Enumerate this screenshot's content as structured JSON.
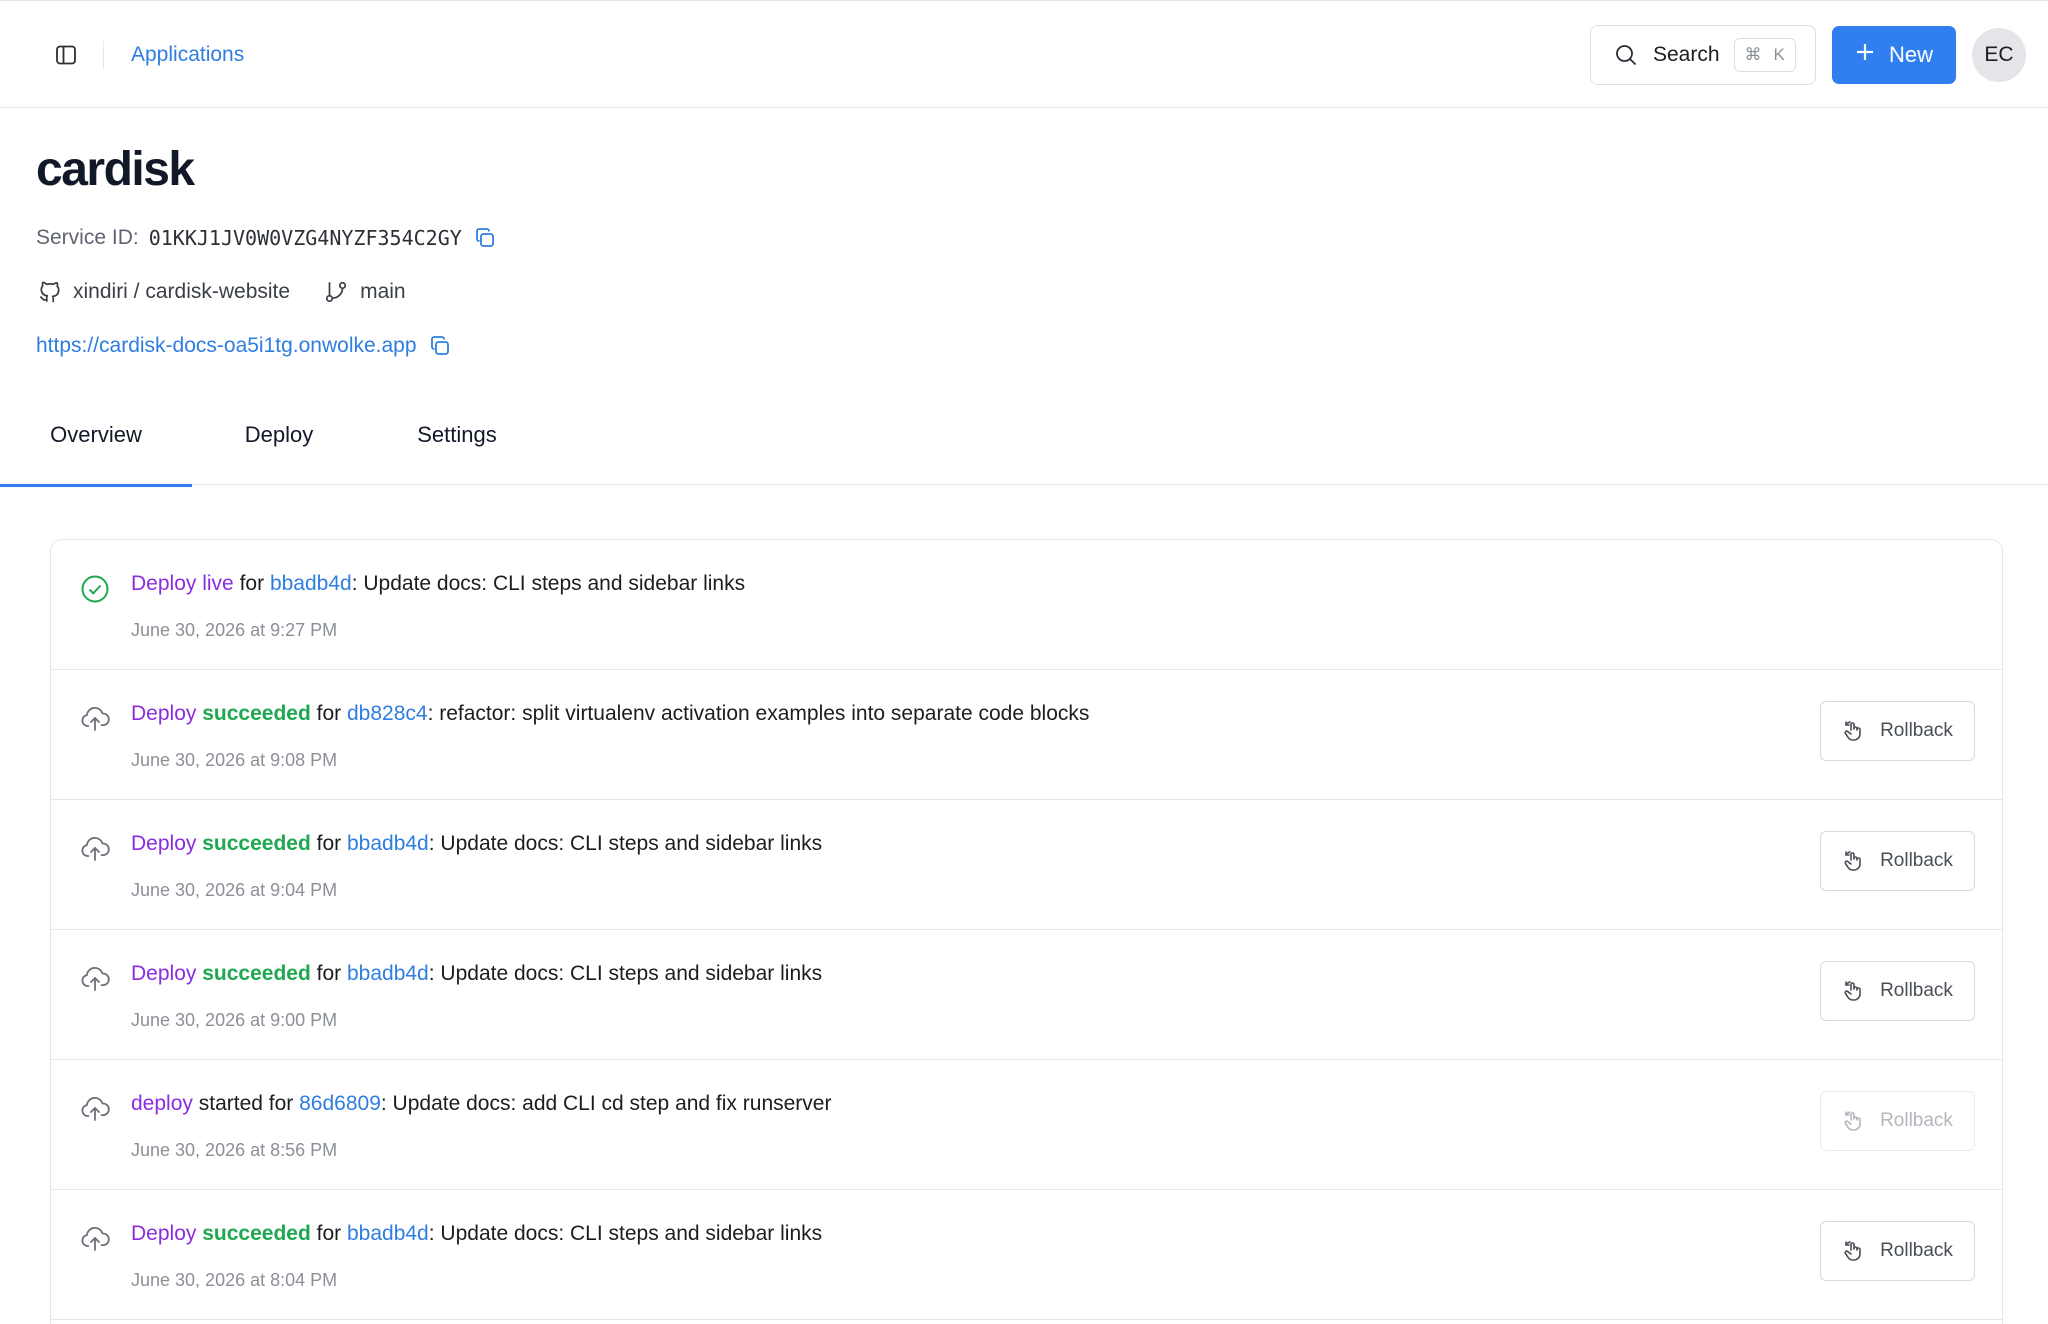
{
  "topbar": {
    "breadcrumb": "Applications",
    "search_label": "Search",
    "search_shortcut_mod": "⌘",
    "search_shortcut_key": "K",
    "new_label": "New",
    "avatar_initials": "EC"
  },
  "service": {
    "name": "cardisk",
    "id_label": "Service ID:",
    "id": "01KKJ1JV0W0VZG4NYZF354C2GY",
    "repo": "xindiri / cardisk-website",
    "branch": "main",
    "url": "https://cardisk-docs-oa5i1tg.onwolke.app"
  },
  "tabs": [
    "Overview",
    "Deploy",
    "Settings"
  ],
  "active_tab": "Overview",
  "colors": {
    "accent": "#2f7ff0",
    "link": "#2f7de1",
    "deploy_purple": "#8b2ce0",
    "success_green": "#1fa84f"
  },
  "events": [
    {
      "icon": "check-circle-icon",
      "word1": "Deploy",
      "status": "live",
      "connector": "for",
      "commit": "bbadb4d",
      "message": ": Update docs: CLI steps and sidebar links",
      "time": "June 30, 2026 at 9:27 PM",
      "rollback": null
    },
    {
      "icon": "cloud-upload-icon",
      "word1": "Deploy",
      "status": "succeeded",
      "connector": "for",
      "commit": "db828c4",
      "message": ": refactor: split virtualenv activation examples into separate code blocks",
      "time": "June 30, 2026 at 9:08 PM",
      "rollback": "Rollback"
    },
    {
      "icon": "cloud-upload-icon",
      "word1": "Deploy",
      "status": "succeeded",
      "connector": "for",
      "commit": "bbadb4d",
      "message": ": Update docs: CLI steps and sidebar links",
      "time": "June 30, 2026 at 9:04 PM",
      "rollback": "Rollback"
    },
    {
      "icon": "cloud-upload-icon",
      "word1": "Deploy",
      "status": "succeeded",
      "connector": "for",
      "commit": "bbadb4d",
      "message": ": Update docs: CLI steps and sidebar links",
      "time": "June 30, 2026 at 9:00 PM",
      "rollback": "Rollback"
    },
    {
      "icon": "cloud-upload-icon",
      "word1": "deploy",
      "status": "",
      "connector": "started for",
      "commit": "86d6809",
      "message": ": Update docs: add CLI cd step and fix runserver",
      "time": "June 30, 2026 at 8:56 PM",
      "rollback": "Rollback"
    },
    {
      "icon": "cloud-upload-icon",
      "word1": "Deploy",
      "status": "succeeded",
      "connector": "for",
      "commit": "bbadb4d",
      "message": ": Update docs: CLI steps and sidebar links",
      "time": "June 30, 2026 at 8:04 PM",
      "rollback": "Rollback"
    }
  ]
}
